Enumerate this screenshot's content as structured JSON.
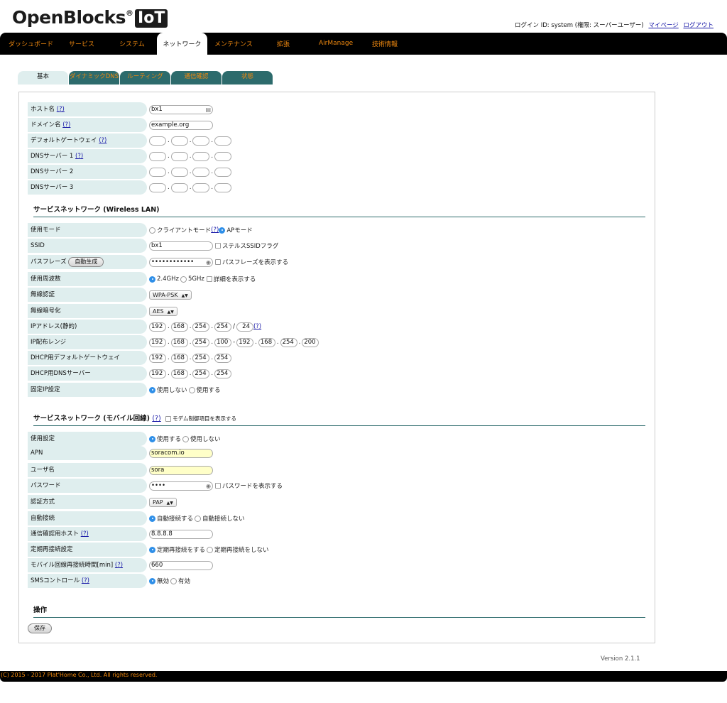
{
  "header": {
    "logo_text": "OpenBlocks",
    "logo_reg": "®",
    "logo_iot": "IoT",
    "login_info": "ログイン ID: system (権限: スーパーユーザー)",
    "mypage_link": "マイページ",
    "logout_link": "ログアウト"
  },
  "nav": [
    "ダッシュボード",
    "サービス",
    "システム",
    "ネットワーク",
    "メンテナンス",
    "拡張",
    "AirManage",
    "技術情報"
  ],
  "subtabs": [
    "基本",
    "ダイナミックDNS",
    "ルーティング",
    "通信確認",
    "状態"
  ],
  "basic": {
    "hostname": {
      "label": "ホスト名",
      "value": "bx1"
    },
    "domain": {
      "label": "ドメイン名",
      "value": "example.org"
    },
    "gateway": {
      "label": "デフォルトゲートウェイ"
    },
    "dns1": {
      "label": "DNSサーバー 1"
    },
    "dns2": {
      "label": "DNSサーバー 2"
    },
    "dns3": {
      "label": "DNSサーバー 3"
    }
  },
  "help": "(?)",
  "dot": ".",
  "slash": "/",
  "dash": "-",
  "wlan": {
    "title": "サービスネットワーク (Wireless LAN)",
    "mode": {
      "label": "使用モード",
      "client": "クライアントモード",
      "ap": "APモード"
    },
    "ssid": {
      "label": "SSID",
      "value": "bx1",
      "stealth": "ステルスSSIDフラグ"
    },
    "passphrase": {
      "label": "パスフレーズ",
      "button": "自動生成",
      "value": "••••••••••••",
      "show": "パスフレーズを表示する"
    },
    "freq": {
      "label": "使用周波数",
      "opt1": "2.4GHz",
      "opt2": "5GHz",
      "detail": "詳細を表示する"
    },
    "auth": {
      "label": "無線認証",
      "value": "WPA-PSK"
    },
    "enc": {
      "label": "無線暗号化",
      "value": "AES"
    },
    "ip": {
      "label": "IPアドレス(静的)",
      "octets": [
        "192",
        "168",
        "254",
        "254"
      ],
      "prefix": "24"
    },
    "range": {
      "label": "IP配布レンジ",
      "start": [
        "192",
        "168",
        "254",
        "100"
      ],
      "end": [
        "192",
        "168",
        "254",
        "200"
      ]
    },
    "dhcp_gw": {
      "label": "DHCP用デフォルトゲートウェイ",
      "octets": [
        "192",
        "168",
        "254",
        "254"
      ]
    },
    "dhcp_dns": {
      "label": "DHCP用DNSサーバー",
      "octets": [
        "192",
        "168",
        "254",
        "254"
      ]
    },
    "fixed_ip": {
      "label": "固定IP設定",
      "opt1": "使用しない",
      "opt2": "使用する"
    }
  },
  "mobile": {
    "title": "サービスネットワーク (モバイル回線)",
    "modem_show": "モデム制御項目を表示する",
    "use": {
      "label": "使用設定",
      "opt1": "使用する",
      "opt2": "使用しない"
    },
    "apn": {
      "label": "APN",
      "value": "soracom.io"
    },
    "user": {
      "label": "ユーザ名",
      "value": "sora"
    },
    "password": {
      "label": "パスワード",
      "value": "••••",
      "show": "パスワードを表示する"
    },
    "auth": {
      "label": "認証方式",
      "value": "PAP"
    },
    "auto": {
      "label": "自動接続",
      "opt1": "自動接続する",
      "opt2": "自動接続しない"
    },
    "check_host": {
      "label": "通信確認用ホスト",
      "value": "8.8.8.8"
    },
    "periodic": {
      "label": "定期再接続設定",
      "opt1": "定期再接続をする",
      "opt2": "定期再接続をしない"
    },
    "interval": {
      "label": "モバイル回線再接続時間[min]",
      "value": "660"
    },
    "sms": {
      "label": "SMSコントロール",
      "opt1": "無効",
      "opt2": "有効"
    }
  },
  "ops": {
    "title": "操作",
    "save": "保存"
  },
  "version": "Version 2.1.1",
  "footer": "(C) 2015 - 2017 Plat'Home Co., Ltd. All rights reserved.",
  "colors": {
    "accent": "#f0890f",
    "tab_bg": "#2d6b6c",
    "label_bg": "#dfeeee",
    "nav_bg": "#000000"
  }
}
